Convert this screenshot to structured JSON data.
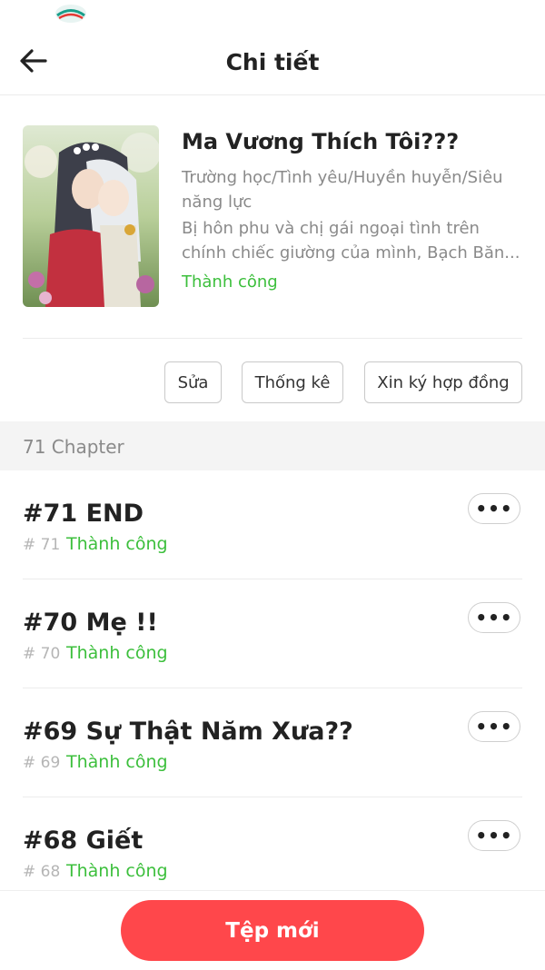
{
  "header": {
    "title": "Chi tiết"
  },
  "book": {
    "title": "Ma Vương Thích Tôi???",
    "genre": "Trường học/Tình yêu/Huyền huyễn/Siêu năng lực",
    "description": "Bị hôn phu và chị gái ngoại tình trên chính chiếc giường của mình, Bạch Băn...",
    "status": "Thành công"
  },
  "actions": {
    "edit": "Sửa",
    "stats": "Thống kê",
    "contract": "Xin ký hợp đồng"
  },
  "section": {
    "label": "71 Chapter"
  },
  "chapters": [
    {
      "title": "#71 END",
      "num": "# 71",
      "status": "Thành công",
      "more": "•••"
    },
    {
      "title": "#70 Mẹ !!",
      "num": "# 70",
      "status": "Thành công",
      "more": "•••"
    },
    {
      "title": "#69 Sự Thật Năm Xưa??",
      "num": "# 69",
      "status": "Thành công",
      "more": "•••"
    },
    {
      "title": "#68 Giết",
      "num": "# 68",
      "status": "Thành công",
      "more": "•••"
    }
  ],
  "footer": {
    "new_file": "Tệp mới"
  },
  "colors": {
    "accent": "#ff474b",
    "success": "#3cbf3c",
    "muted": "#8a8a8a"
  },
  "icons": {
    "back": "arrow-left-icon",
    "more": "ellipsis-icon",
    "carrier": "viettel-logo"
  }
}
